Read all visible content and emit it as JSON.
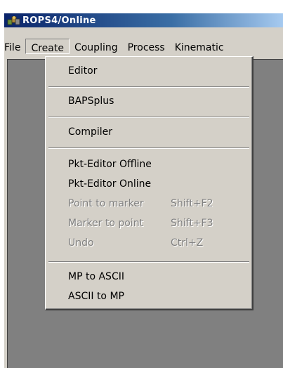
{
  "window": {
    "title": "ROPS4/Online"
  },
  "menubar": {
    "items": [
      {
        "label": "File"
      },
      {
        "label": "Create"
      },
      {
        "label": "Coupling"
      },
      {
        "label": "Process"
      },
      {
        "label": "Kinematic"
      }
    ]
  },
  "dropdown": {
    "items": [
      {
        "label": "Editor",
        "shortcut": "",
        "enabled": true
      },
      {
        "label": "BAPSplus",
        "shortcut": "",
        "enabled": true
      },
      {
        "label": "Compiler",
        "shortcut": "",
        "enabled": true
      },
      {
        "label": "Pkt-Editor Offline",
        "shortcut": "",
        "enabled": true
      },
      {
        "label": "Pkt-Editor Online",
        "shortcut": "",
        "enabled": true
      },
      {
        "label": "Point to marker",
        "shortcut": "Shift+F2",
        "enabled": false
      },
      {
        "label": "Marker to point",
        "shortcut": "Shift+F3",
        "enabled": false
      },
      {
        "label": "Undo",
        "shortcut": "Ctrl+Z",
        "enabled": false
      },
      {
        "label": "MP to ASCII",
        "shortcut": "",
        "enabled": true
      },
      {
        "label": "ASCII to MP",
        "shortcut": "",
        "enabled": true
      }
    ]
  },
  "icons": {
    "app": "app-logo-icon"
  },
  "colors": {
    "titlebar_start": "#0a246a",
    "titlebar_end": "#a6caf0",
    "face": "#d4d0c8",
    "client": "#808080",
    "disabled_text": "#808080"
  }
}
